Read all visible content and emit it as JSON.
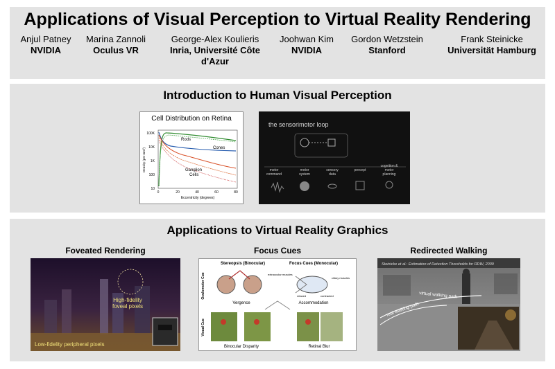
{
  "header": {
    "title": "Applications of Visual Perception to Virtual Reality Rendering",
    "authors": [
      {
        "name": "Anjul Patney",
        "affiliation": "NVIDIA"
      },
      {
        "name": "Marina Zannoli",
        "affiliation": "Oculus VR"
      },
      {
        "name": "George-Alex Koulieris",
        "affiliation_line1": "Inria, Université Côte",
        "affiliation_line2": "d'Azur"
      },
      {
        "name": "Joohwan Kim",
        "affiliation": "NVIDIA"
      },
      {
        "name": "Gordon Wetzstein",
        "affiliation": "Stanford"
      },
      {
        "name": "Frank Steinicke",
        "affiliation": "Universität Hamburg"
      }
    ]
  },
  "intro": {
    "title": "Introduction to Human Visual Perception",
    "retina": {
      "title": "Cell Distribution on Retina",
      "ylabel": "Density (per mm²)",
      "xlabel": "Eccentricity (degrees)",
      "yticks": [
        "100K",
        "10K",
        "1K",
        "100",
        "10"
      ],
      "xticks": [
        "0",
        "20",
        "40",
        "60",
        "80"
      ],
      "label_rods": "Rods",
      "label_cones": "Cones",
      "label_ganglion_1": "Ganglion",
      "label_ganglion_2": "Cells"
    },
    "loop": {
      "title": "the sensorimotor loop",
      "boxes": [
        "motor command",
        "motor system",
        "sensory data",
        "percept",
        "cognition & motor planning"
      ],
      "b1a": "motor",
      "b1b": "command",
      "b2a": "motor",
      "b2b": "system",
      "b3a": "sensory",
      "b3b": "data",
      "b4a": "percept",
      "b5a": "cognition &",
      "b5b": "motor",
      "b5c": "planning"
    }
  },
  "apps": {
    "title": "Applications to Virtual Reality Graphics",
    "foveated": {
      "heading": "Foveated Rendering",
      "label_high_1": "High-fidelity",
      "label_high_2": "foveal pixels",
      "label_low": "Low-fidelity peripheral pixels"
    },
    "focus": {
      "heading": "Focus Cues",
      "col1": "Stereopsis (Binocular)",
      "col2": "Focus Cues (Monocular)",
      "row1": "Oculomotor Cue",
      "row2": "Visual Cue",
      "vergence": "Vergence",
      "accommodation": "Accommodation",
      "disparity": "Binocular Disparity",
      "blur": "Retinal Blur",
      "muscles": "extraocular muscles",
      "ciliary": "ciliary muscles",
      "relaxed": "relaxed",
      "contracted": "contracted"
    },
    "walking": {
      "heading": "Redirected Walking",
      "caption": "Steinicke et al.: Estimation of Detection Thresholds for RDW, 2009",
      "virtual_path": "virtual walking path",
      "real_path": "real walking path"
    }
  }
}
